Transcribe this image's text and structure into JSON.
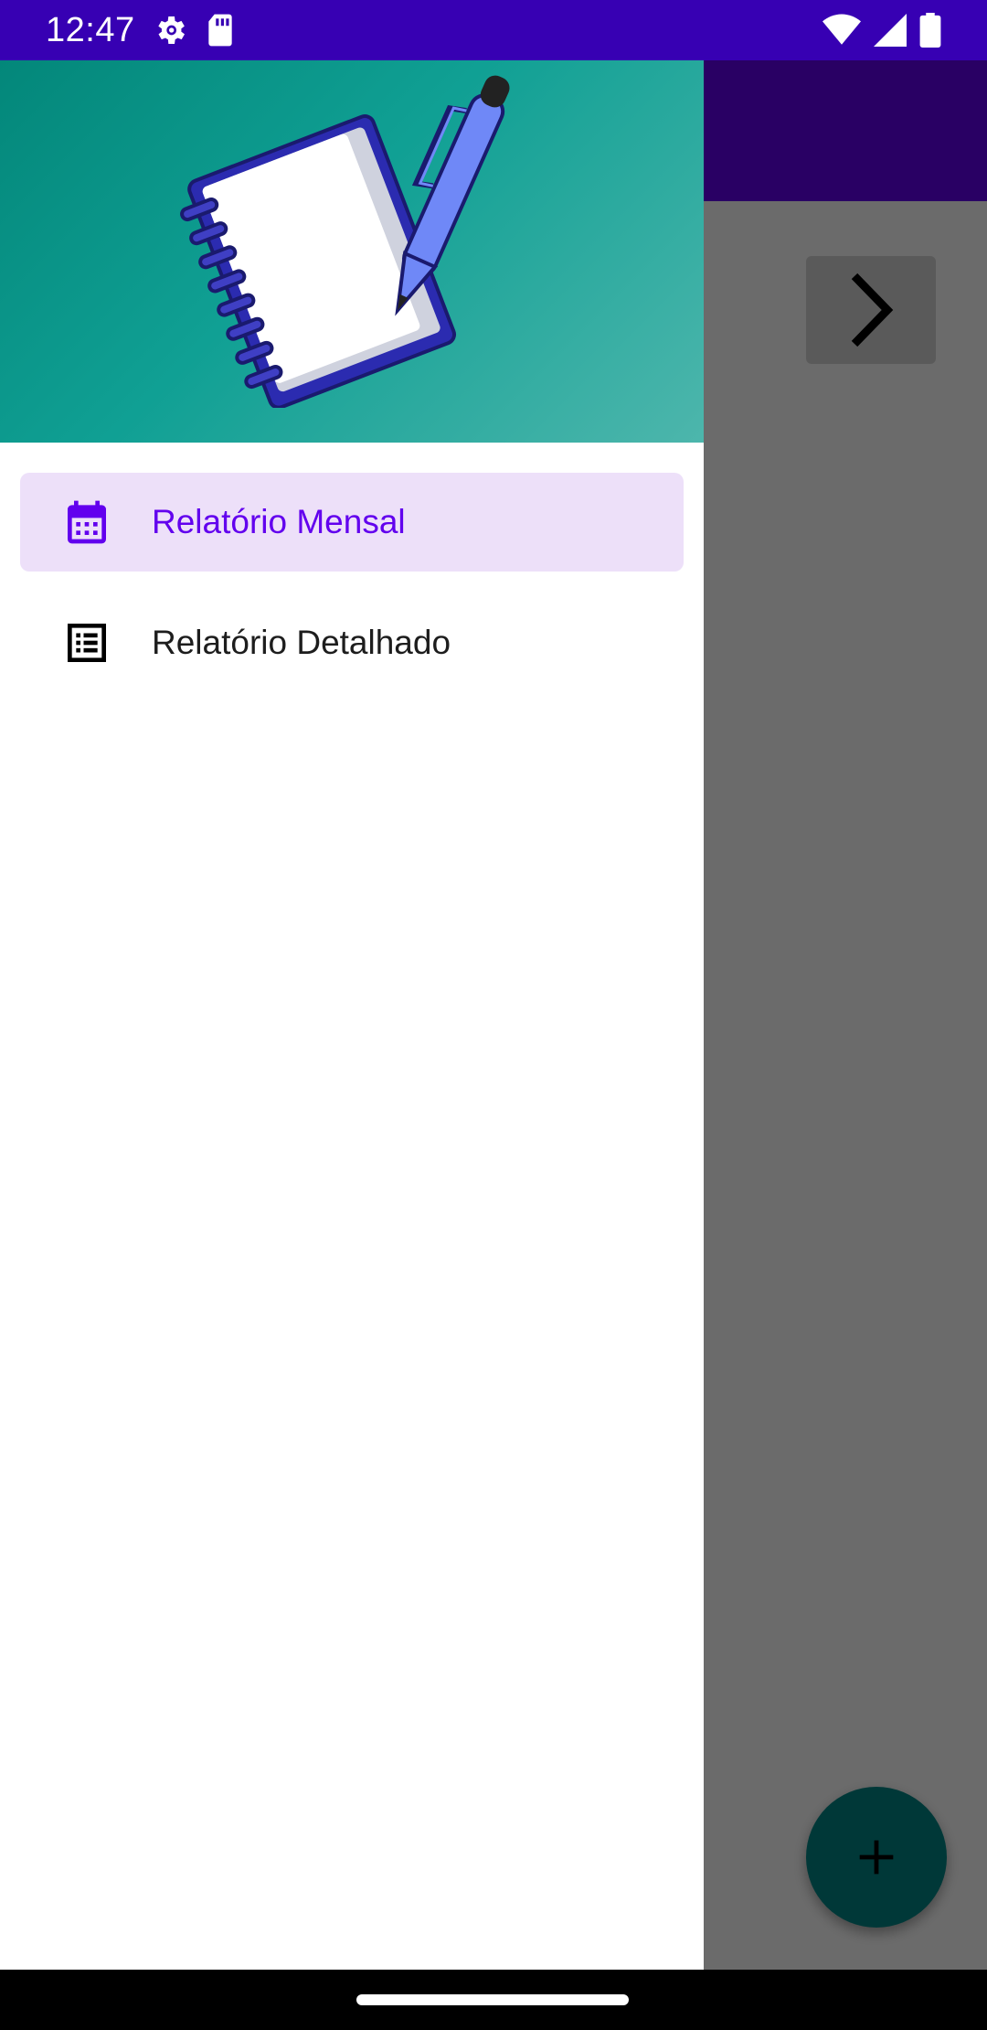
{
  "status_bar": {
    "time": "12:47",
    "left_icons": [
      "settings-gear-icon",
      "sd-card-icon"
    ],
    "right_icons": [
      "wifi-icon",
      "cell-signal-icon",
      "battery-icon"
    ]
  },
  "drawer": {
    "header_image": "notebook-with-pen-logo",
    "items": [
      {
        "label": "Relatório Mensal",
        "icon": "calendar-icon",
        "selected": true
      },
      {
        "label": "Relatório Detalhado",
        "icon": "list-document-icon",
        "selected": false
      }
    ]
  },
  "background_app": {
    "next_button_icon": "chevron-right-icon",
    "fab_icon": "plus-icon"
  },
  "colors": {
    "status_bar": "#3700b3",
    "toolbar": "#6200ee",
    "drawer_header_start": "#03877a",
    "drawer_header_end": "#4db6ac",
    "selected_item_bg": "#ede0f9",
    "selected_item_text": "#6200ee",
    "fab": "#018786"
  }
}
